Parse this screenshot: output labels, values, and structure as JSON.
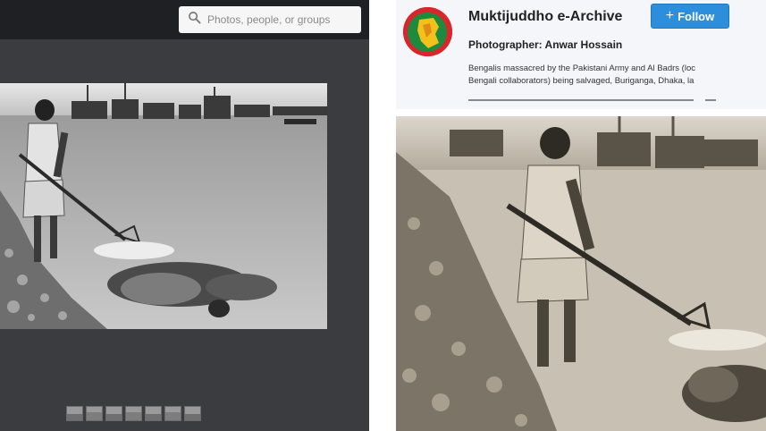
{
  "search": {
    "placeholder": "Photos, people, or groups",
    "icon": "search-icon"
  },
  "viewer": {
    "thumbnail_count": 7
  },
  "post": {
    "account_name": "Muktijuddho e-Archive",
    "follow_label": "Follow",
    "follow_icon": "+",
    "photographer": "Photographer: Anwar Hossain",
    "caption_lines": [
      "Bengalis massacred by the Pakistani Army and Al Badrs (loc",
      "Bengali collaborators) being salvaged, Buriganga, Dhaka, la"
    ]
  },
  "colors": {
    "viewer_bg": "#3b3c40",
    "viewer_topbar": "#1f2023",
    "follow_blue": "#2d8fdb",
    "header_bg": "#f4f6f9"
  }
}
